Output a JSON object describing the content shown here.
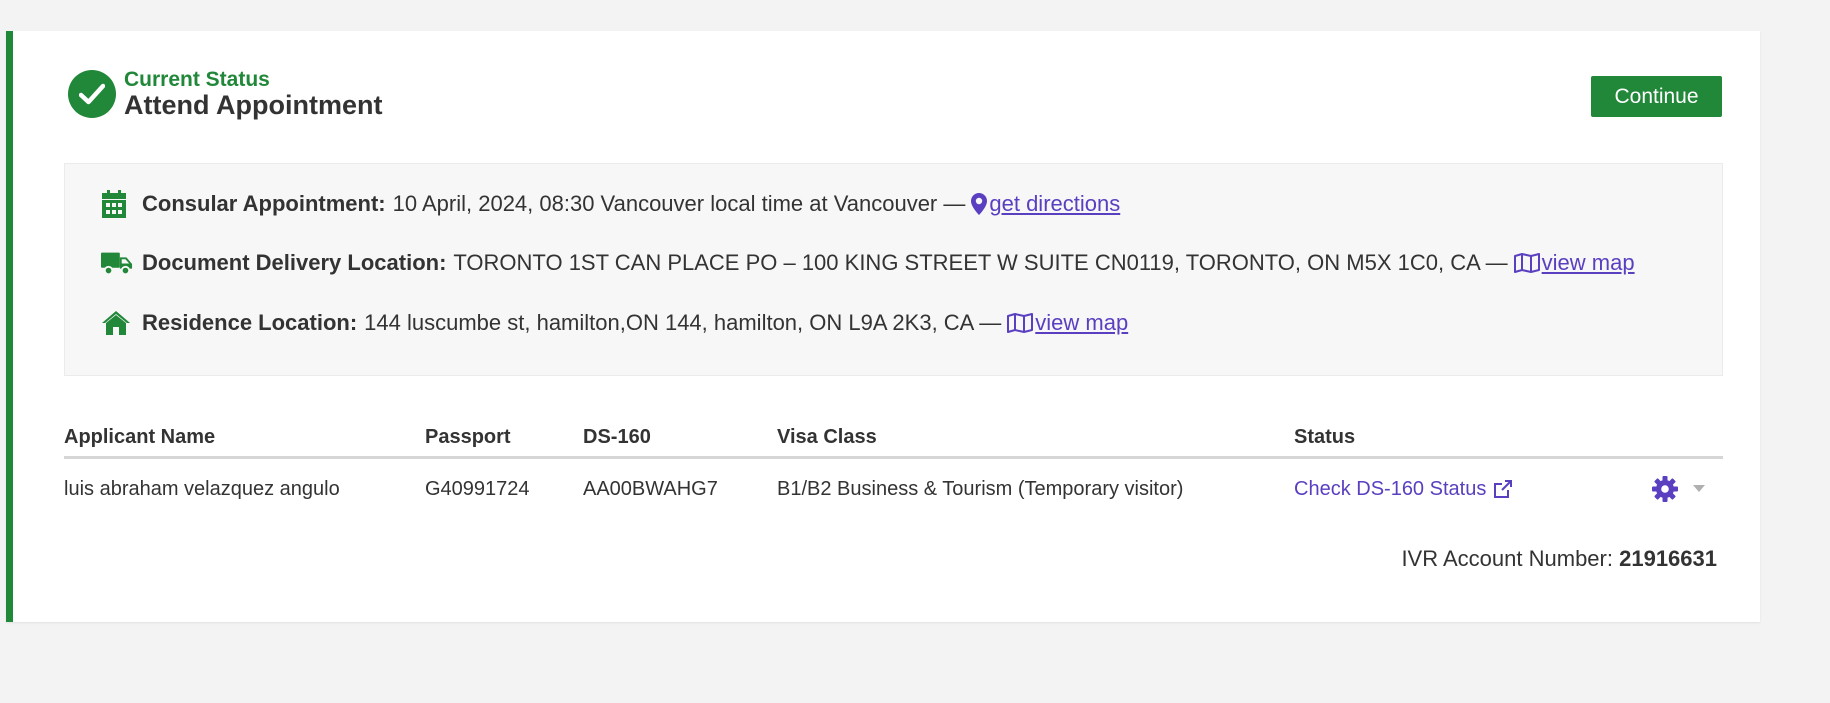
{
  "status": {
    "label": "Current Status",
    "value": "Attend Appointment"
  },
  "actions": {
    "continue_label": "Continue"
  },
  "info": {
    "consular": {
      "label": "Consular Appointment:",
      "value": "10 April, 2024, 08:30 Vancouver local time at Vancouver —",
      "link": "get directions",
      "icon": "calendar-icon"
    },
    "delivery": {
      "label": "Document Delivery Location:",
      "value": "TORONTO 1ST CAN PLACE PO – 100 KING STREET W SUITE CN0119, TORONTO, ON M5X 1C0, CA —",
      "link": "view map",
      "icon": "truck-icon"
    },
    "residence": {
      "label": "Residence Location:",
      "value": "144 luscumbe st, hamilton,ON 144, hamilton, ON L9A 2K3, CA —",
      "link": "view map",
      "icon": "home-icon"
    }
  },
  "table": {
    "headers": [
      "Applicant Name",
      "Passport",
      "DS-160",
      "Visa Class",
      "Status",
      ""
    ],
    "rows": [
      {
        "name": "luis abraham velazquez angulo",
        "passport": "G40991724",
        "ds160": "AA00BWAHG7",
        "visa_class": "B1/B2 Business & Tourism (Temporary visitor)",
        "status_link": "Check DS-160 Status"
      }
    ]
  },
  "ivr": {
    "label": "IVR Account Number:",
    "value": "21916631"
  },
  "colors": {
    "brand_green": "#218739",
    "link_purple": "#5a3fc0",
    "background": "#f3f3f3"
  }
}
